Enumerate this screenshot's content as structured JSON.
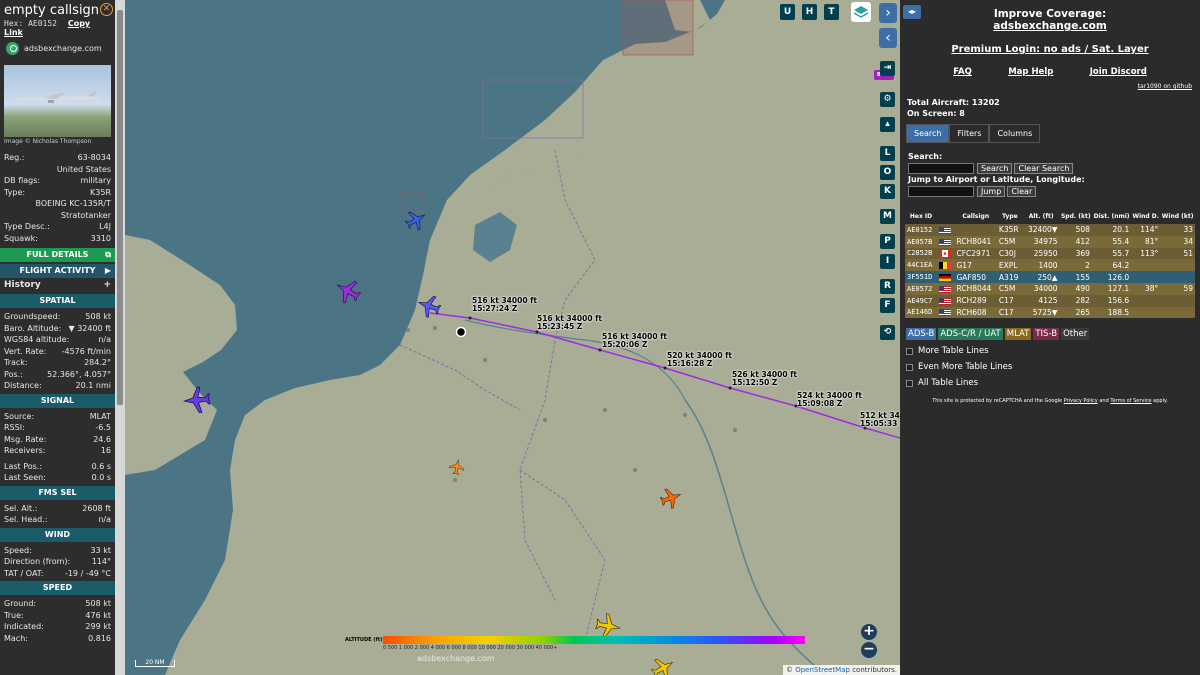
{
  "left": {
    "callsign": "empty callsign",
    "hex_label": "Hex:",
    "hex": "AE0152",
    "copy_link": "Copy Link",
    "site": "adsbexchange.com",
    "image_credit": "Image © Nicholas Thompson",
    "info": [
      {
        "k": "Reg.:",
        "v": "63-8034"
      },
      {
        "k": "",
        "v": "United States"
      },
      {
        "k": "DB flags:",
        "v": "military"
      },
      {
        "k": "Type:",
        "v": "K35R"
      },
      {
        "k": "",
        "v": "BOEING KC-135R/T"
      },
      {
        "k": "",
        "v": "Stratotanker"
      },
      {
        "k": "Type Desc.:",
        "v": "L4J"
      },
      {
        "k": "Squawk:",
        "v": "3310"
      }
    ],
    "full_details": "FULL DETAILS",
    "flight_activity": "FLIGHT ACTIVITY",
    "history": "History",
    "spatial_title": "SPATIAL",
    "spatial": [
      {
        "k": "Groundspeed:",
        "v": "508 kt"
      },
      {
        "k": "Baro. Altitude:",
        "v": "▼ 32400 ft"
      },
      {
        "k": "WGS84 altitude:",
        "v": "n/a"
      },
      {
        "k": "Vert. Rate:",
        "v": "-4576 ft/min"
      },
      {
        "k": "Track:",
        "v": "284.2°"
      },
      {
        "k": "Pos.:",
        "v": "52.366°, 4.057°"
      },
      {
        "k": "Distance:",
        "v": "20.1 nmi"
      }
    ],
    "signal_title": "SIGNAL",
    "signal": [
      {
        "k": "Source:",
        "v": "MLAT"
      },
      {
        "k": "RSSI:",
        "v": "-6.5"
      },
      {
        "k": "Msg. Rate:",
        "v": "24.6"
      },
      {
        "k": "Receivers:",
        "v": "16"
      }
    ],
    "signal2": [
      {
        "k": "Last Pos.:",
        "v": "0.6 s"
      },
      {
        "k": "Last Seen:",
        "v": "0.0 s"
      }
    ],
    "fms_title": "FMS SEL",
    "fms": [
      {
        "k": "Sel. Alt.:",
        "v": "2608 ft"
      },
      {
        "k": "Sel. Head.:",
        "v": "n/a"
      }
    ],
    "wind_title": "WIND",
    "wind": [
      {
        "k": "Speed:",
        "v": "33 kt"
      },
      {
        "k": "Direction (from):",
        "v": "114°"
      },
      {
        "k": "TAT / OAT:",
        "v": "-19 / -49 °C"
      }
    ],
    "speed_title": "SPEED",
    "speed": [
      {
        "k": "Ground:",
        "v": "508 kt"
      },
      {
        "k": "True:",
        "v": "476 kt"
      },
      {
        "k": "Indicated:",
        "v": "299 kt"
      },
      {
        "k": "Mach:",
        "v": "0.816"
      }
    ]
  },
  "map": {
    "top_buttons": [
      "U",
      "H",
      "T"
    ],
    "side_buttons": [
      "L",
      "O",
      "K",
      "M",
      "P",
      "I",
      "R",
      "F"
    ],
    "beta_label": "BETA",
    "track_labels": [
      {
        "l1": "516 kt  34000 ft",
        "l2": "15:27:24 Z"
      },
      {
        "l1": "516 kt  34000 ft",
        "l2": "15:23:45 Z"
      },
      {
        "l1": "516 kt  34000 ft",
        "l2": "15:20:06 Z"
      },
      {
        "l1": "520 kt  34000 ft",
        "l2": "15:16:28 Z"
      },
      {
        "l1": "526 kt  34000 ft",
        "l2": "15:12:50 Z"
      },
      {
        "l1": "524 kt  34000 ft",
        "l2": "15:09:08 Z"
      },
      {
        "l1": "512 kt  34",
        "l2": "15:05:33 Z"
      }
    ],
    "legend_title": "ALTITUDE (ft)",
    "legend_ticks": "0   500  1 000    2 000    4 000    6 000    8 000    10 000               20 000               30 000            40 000+",
    "scale": "20 NM",
    "attribution_prefix": "© ",
    "attribution_link": "OpenStreetMap",
    "attribution_suffix": " contributors.",
    "watermark": "adsbexchange.com"
  },
  "right": {
    "improve": "Improve Coverage:",
    "site": "adsbexchange.com",
    "premium": "Premium Login: no ads / Sat. Layer",
    "links": [
      "FAQ",
      "Map Help",
      "Join Discord"
    ],
    "tar": "tar1090 on github",
    "total_label": "Total Aircraft:",
    "total": "13202",
    "onscreen_label": "On Screen:",
    "onscreen": "8",
    "tabs": [
      "Search",
      "Filters",
      "Columns"
    ],
    "search_label": "Search:",
    "search_btn": "Search",
    "clear_search_btn": "Clear Search",
    "jump_label": "Jump to Airport or Latitude, Longitude:",
    "jump_btn": "Jump",
    "clear_btn": "Clear",
    "columns": [
      "Hex ID",
      "",
      "Callsign",
      "Type",
      "Alt. (ft)",
      "Spd. (kt)",
      "Dist. (nmi)",
      "Wind D.",
      "Wind (kt)"
    ],
    "rows": [
      {
        "hex": "AE0152",
        "flag": "us",
        "cs": "",
        "type": "K35R",
        "alt": "32400▼",
        "spd": "508",
        "dist": "20.1",
        "wd": "114°",
        "wk": "33"
      },
      {
        "hex": "AE057B",
        "flag": "us",
        "cs": "RCH8041",
        "type": "C5M",
        "alt": "34975",
        "spd": "412",
        "dist": "55.4",
        "wd": "81°",
        "wk": "34"
      },
      {
        "hex": "C2852B",
        "flag": "ca",
        "cs": "CFC2971",
        "type": "C30J",
        "alt": "25950",
        "spd": "369",
        "dist": "55.7",
        "wd": "113°",
        "wk": "51"
      },
      {
        "hex": "44C1EA",
        "flag": "be",
        "cs": "G17",
        "type": "EXPL",
        "alt": "1400",
        "spd": "2",
        "dist": "64.2",
        "wd": "",
        "wk": ""
      },
      {
        "hex": "3F551D",
        "flag": "de",
        "cs": "GAF850",
        "type": "A319",
        "alt": "250▲",
        "spd": "155",
        "dist": "126.0",
        "wd": "",
        "wk": ""
      },
      {
        "hex": "AE0572",
        "flag": "us",
        "cs": "RCH8044",
        "type": "C5M",
        "alt": "34000",
        "spd": "490",
        "dist": "127.1",
        "wd": "38°",
        "wk": "59"
      },
      {
        "hex": "AE49C7",
        "flag": "us",
        "cs": "RCH289",
        "type": "C17",
        "alt": "4125",
        "spd": "282",
        "dist": "156.6",
        "wd": "",
        "wk": ""
      },
      {
        "hex": "AE146D",
        "flag": "us",
        "cs": "RCH608",
        "type": "C17",
        "alt": "5725▼",
        "spd": "265",
        "dist": "188.5",
        "wd": "",
        "wk": ""
      }
    ],
    "sources": [
      {
        "label": "ADS-B",
        "color": "#3e6ea8"
      },
      {
        "label": "ADS-C/R / UAT",
        "color": "#2a7a5a"
      },
      {
        "label": "MLAT",
        "color": "#8a6a1e"
      },
      {
        "label": "TIS-B",
        "color": "#7a2a4a"
      },
      {
        "label": "Other",
        "color": "#3a3a3a"
      }
    ],
    "checks": [
      "More Table Lines",
      "Even More Table Lines",
      "All Table Lines"
    ],
    "captcha_pre": "This site is protected by reCAPTCHA and the Google ",
    "captcha_privacy": "Privacy Policy",
    "captcha_and": " and ",
    "captcha_terms": "Terms of Service",
    "captcha_post": " apply."
  }
}
